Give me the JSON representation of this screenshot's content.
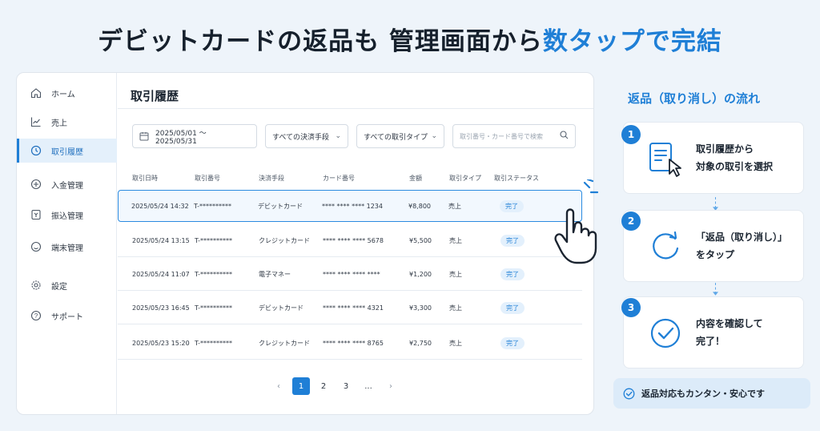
{
  "headline": {
    "prefix": "デビットカードの返品も 管理画面から",
    "accent": "数タップで完結"
  },
  "sidebar": {
    "items": [
      {
        "label": "ホーム",
        "icon": "home-icon"
      },
      {
        "label": "売上",
        "icon": "chart-line-icon"
      },
      {
        "label": "取引履歴",
        "icon": "history-icon",
        "active": true
      },
      {
        "label": "入金管理",
        "icon": "deposit-icon"
      },
      {
        "label": "振込管理",
        "icon": "transfer-icon"
      },
      {
        "label": "端末管理",
        "icon": "terminal-icon"
      },
      {
        "label": "設定",
        "icon": "gear-icon"
      },
      {
        "label": "サポート",
        "icon": "help-icon"
      }
    ]
  },
  "main": {
    "title": "取引履歴",
    "filters": {
      "date_range": "2025/05/01 ～ 2025/05/31",
      "method": "すべての決済手段",
      "type": "すべての取引タイプ",
      "search_placeholder": "取引番号・カード番号で検索"
    },
    "table": {
      "headers": [
        "取引日時",
        "取引番号",
        "決済手段",
        "カード番号",
        "金額",
        "取引タイプ",
        "取引ステータス"
      ],
      "rows": [
        {
          "datetime": "2025/05/24 14:32",
          "id": "T-**********",
          "method": "デビットカード",
          "card": "**** **** **** 1234",
          "amount": "¥8,800",
          "type": "売上",
          "status": "完了",
          "selected": true
        },
        {
          "datetime": "2025/05/24 13:15",
          "id": "T-**********",
          "method": "クレジットカード",
          "card": "**** **** **** 5678",
          "amount": "¥5,500",
          "type": "売上",
          "status": "完了"
        },
        {
          "datetime": "2025/05/24 11:07",
          "id": "T-**********",
          "method": "電子マネー",
          "card": "**** **** **** ****",
          "amount": "¥1,200",
          "type": "売上",
          "status": "完了"
        },
        {
          "datetime": "2025/05/23 16:45",
          "id": "T-**********",
          "method": "デビットカード",
          "card": "**** **** **** 4321",
          "amount": "¥3,300",
          "type": "売上",
          "status": "完了"
        },
        {
          "datetime": "2025/05/23 15:20",
          "id": "T-**********",
          "method": "クレジットカード",
          "card": "**** **** **** 8765",
          "amount": "¥2,750",
          "type": "売上",
          "status": "完了"
        }
      ]
    },
    "pagination": {
      "prev": "‹",
      "pages": [
        "1",
        "2",
        "3",
        "..."
      ],
      "current": "1",
      "next": "›"
    }
  },
  "flow": {
    "title": "返品（取り消し）の流れ",
    "steps": [
      {
        "number": "1",
        "line1": "取引履歴から",
        "line2": "対象の取引を選択",
        "icon": "document-cursor-icon"
      },
      {
        "number": "2",
        "line1": "「返品（取り消し）」",
        "line2": "をタップ",
        "icon": "refresh-icon"
      },
      {
        "number": "3",
        "line1": "内容を確認して",
        "line2": "完了！",
        "icon": "check-circle-icon"
      }
    ],
    "footer": "返品対応もカンタン・安心です"
  },
  "colors": {
    "accent": "#1f7fd6",
    "background": "#eef4fa",
    "badge_bg": "#e3f0fc"
  }
}
